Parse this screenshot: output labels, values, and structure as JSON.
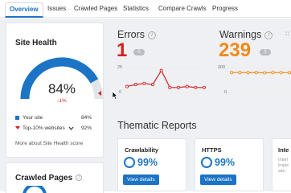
{
  "tabs": [
    {
      "label": "Overview",
      "active": true
    },
    {
      "label": "Issues"
    },
    {
      "label": "Crawled Pages"
    },
    {
      "label": "Statistics"
    },
    {
      "label": "Compare Crawls"
    },
    {
      "label": "Progress"
    }
  ],
  "site_health": {
    "title": "Site Health",
    "value": "84%",
    "delta": "-1%",
    "score_fraction": 0.84,
    "legend": [
      {
        "label": "Your site",
        "value": "84%",
        "color": "#1b74c5"
      },
      {
        "label": "Top-10% websites",
        "value": "92%",
        "color": "#d0231f"
      }
    ],
    "more_link": "More about Site Health score"
  },
  "crawled_pages": {
    "title": "Crawled Pages",
    "info": "i"
  },
  "errors": {
    "title": "Errors",
    "info": "i",
    "value": "1",
    "badge": "0",
    "color": "#d0231f",
    "axis_ticks": [
      "25",
      "0"
    ],
    "chart_data": {
      "type": "line",
      "ylim": [
        0,
        25
      ],
      "values": [
        6,
        8,
        9,
        8,
        22,
        5,
        5,
        6,
        5,
        5
      ]
    }
  },
  "warnings": {
    "title": "Warnings",
    "info": "i",
    "value": "239",
    "badge": "0",
    "color": "#f08a18",
    "axis_ticks": [
      "300",
      "0"
    ],
    "chart_data": {
      "type": "line",
      "ylim": [
        0,
        300
      ],
      "values": [
        240,
        240,
        238,
        240,
        237,
        240,
        239,
        239
      ]
    }
  },
  "thematic": {
    "title": "Thematic Reports",
    "cards": [
      {
        "title": "Crawlability",
        "value": "99%",
        "button": "View details"
      },
      {
        "title": "HTTPS",
        "value": "99%",
        "button": "View details"
      },
      {
        "title": "Inte",
        "lines": [
          "Interl",
          "imple",
          "site."
        ]
      }
    ]
  }
}
